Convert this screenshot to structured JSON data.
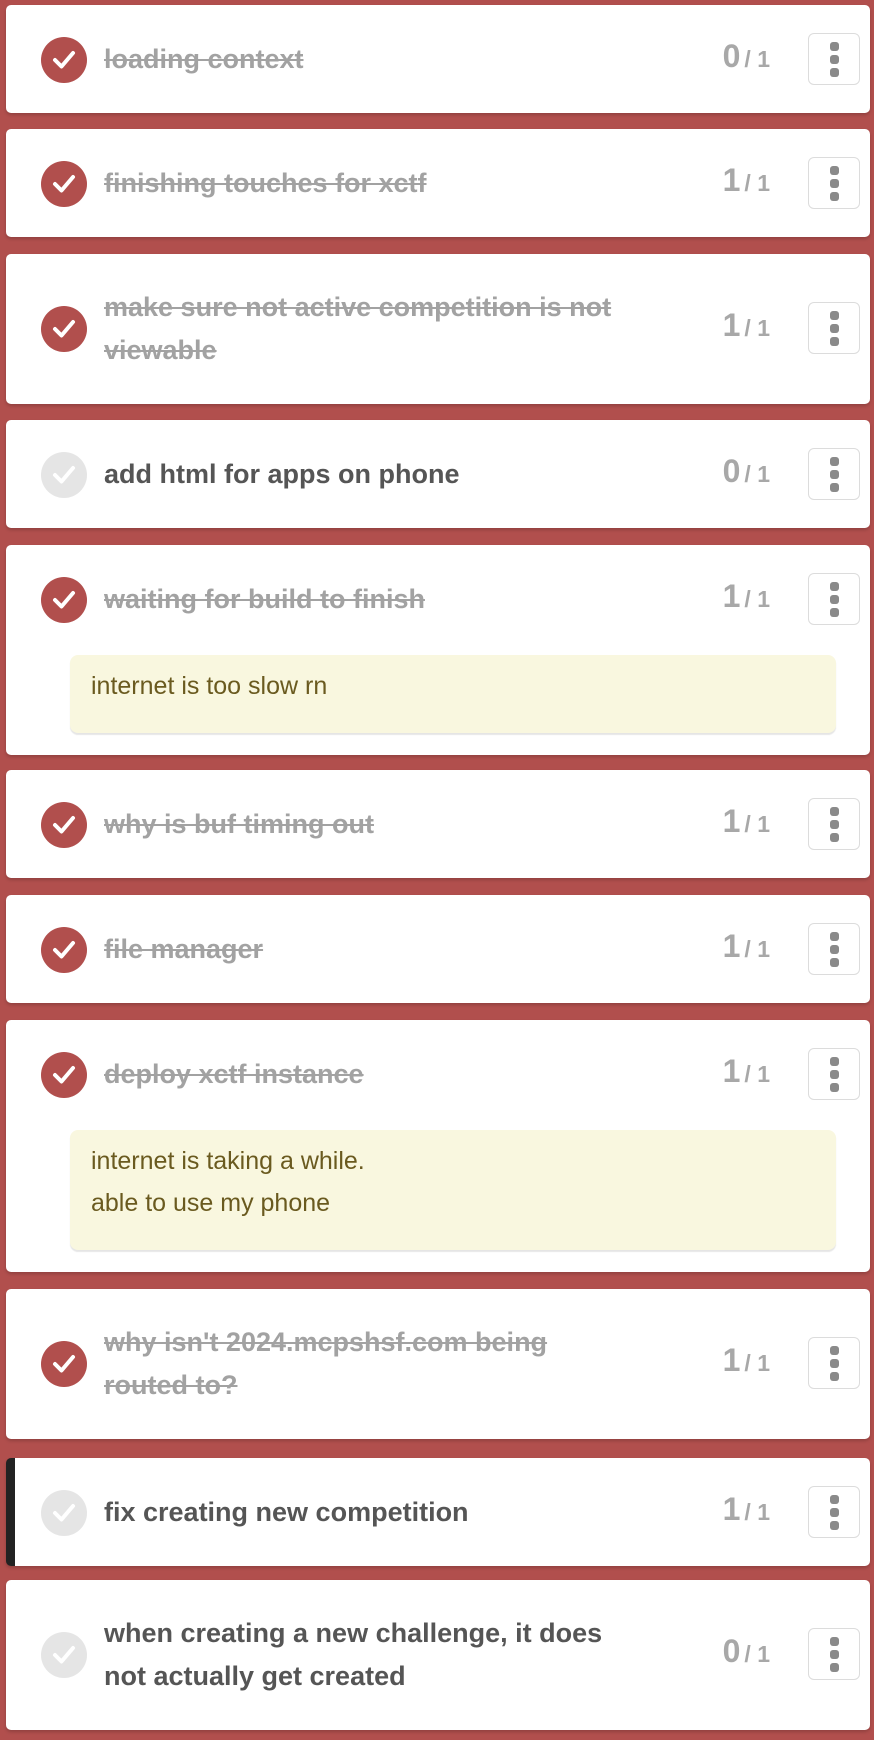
{
  "items": [
    {
      "title": "loading context",
      "done": true,
      "count": "0",
      "total": "/ 1",
      "note": ""
    },
    {
      "title": "finishing touches for xctf",
      "done": true,
      "count": "1",
      "total": "/ 1",
      "note": ""
    },
    {
      "title": "make sure not active competition is not viewable",
      "done": true,
      "count": "1",
      "total": "/ 1",
      "note": ""
    },
    {
      "title": "add html for apps on phone",
      "done": false,
      "count": "0",
      "total": "/ 1",
      "note": ""
    },
    {
      "title": "waiting for build to finish",
      "done": true,
      "count": "1",
      "total": "/ 1",
      "note": "internet is too slow rn"
    },
    {
      "title": "why is buf timing out",
      "done": true,
      "count": "1",
      "total": "/ 1",
      "note": ""
    },
    {
      "title": "file manager",
      "done": true,
      "count": "1",
      "total": "/ 1",
      "note": ""
    },
    {
      "title": "deploy xctf instance",
      "done": true,
      "count": "1",
      "total": "/ 1",
      "note": "internet is taking a while.\nable to use my phone"
    },
    {
      "title": "why isn't 2024.mcpshsf.com being routed to?",
      "done": true,
      "count": "1",
      "total": "/ 1",
      "note": ""
    },
    {
      "title": "fix creating new competition",
      "done": false,
      "active": true,
      "count": "1",
      "total": "/ 1",
      "note": ""
    },
    {
      "title": "when creating a new challenge, it does not actually get created",
      "done": false,
      "count": "0",
      "total": "/ 1",
      "note": ""
    }
  ],
  "colors": {
    "background": "#b14f4d",
    "check_done": "#b14f4d",
    "check_pending": "#e5e5e5",
    "note_background": "#f9f7df"
  },
  "icons": {
    "check": "checkmark-icon",
    "menu": "kebab-menu-icon"
  }
}
